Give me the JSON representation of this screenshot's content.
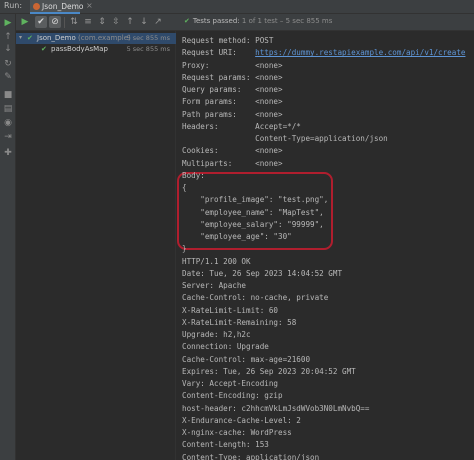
{
  "run_tab": {
    "run_label": "Run:",
    "tab_title": "Json_Demo",
    "close_glyph": "×"
  },
  "toolbar": {
    "buttons": [
      {
        "name": "rerun-icon",
        "glyph": "▶"
      },
      {
        "name": "show-passed-icon",
        "glyph": "✔"
      },
      {
        "name": "show-ignored-icon",
        "glyph": "⊘"
      },
      {
        "name": "sort-alpha-icon",
        "glyph": "⇅"
      },
      {
        "name": "sort-duration-icon",
        "glyph": "≡"
      },
      {
        "name": "expand-all-icon",
        "glyph": "⇕"
      },
      {
        "name": "collapse-all-icon",
        "glyph": "⇳"
      },
      {
        "name": "previous-icon",
        "glyph": "↑"
      },
      {
        "name": "next-icon",
        "glyph": "↓"
      },
      {
        "name": "export-icon",
        "glyph": "↗"
      },
      {
        "name": "history-icon",
        "glyph": "◷"
      },
      {
        "name": "settings-icon",
        "glyph": "⚙"
      }
    ],
    "status_check": "✔",
    "status_passed": "Tests passed:",
    "status_rest": " 1 of 1 test – 5 sec 855 ms"
  },
  "left_toolbar": {
    "buttons": [
      {
        "name": "run-icon",
        "glyph": "▶"
      },
      {
        "name": "up-icon",
        "glyph": "↑"
      },
      {
        "name": "down-icon",
        "glyph": "↓"
      },
      {
        "name": "rerun-failed-icon",
        "glyph": "↻"
      },
      {
        "name": "wrench-icon",
        "glyph": "✎"
      },
      {
        "name": "stop-icon",
        "glyph": "■"
      },
      {
        "name": "layout-icon",
        "glyph": "▤"
      },
      {
        "name": "camera-icon",
        "glyph": "◉"
      },
      {
        "name": "exit-icon",
        "glyph": "⇥"
      },
      {
        "name": "pin-icon",
        "glyph": "✚"
      }
    ]
  },
  "tree": {
    "root": {
      "arrow": "▾",
      "check": "✔",
      "name": "Json_Demo",
      "sub": " (com.example)",
      "time": "5 sec 855 ms"
    },
    "child": {
      "check": "✔",
      "name": "passBodyAsMap",
      "time": "5 sec 855 ms"
    }
  },
  "console": {
    "lines": [
      "Request method: POST",
      "Request URI:    ",
      "Proxy:          <none>",
      "Request params: <none>",
      "Query params:   <none>",
      "Form params:    <none>",
      "Path params:    <none>",
      "Headers:        Accept=*/*",
      "                Content-Type=application/json",
      "Cookies:        <none>",
      "Multiparts:     <none>",
      "Body:",
      "{",
      "    \"profile_image\": \"test.png\",",
      "    \"employee_name\": \"MapTest\",",
      "    \"employee_salary\": \"99999\",",
      "    \"employee_age\": \"30\"",
      "}",
      "HTTP/1.1 200 OK",
      "Date: Tue, 26 Sep 2023 14:04:52 GMT",
      "Server: Apache",
      "Cache-Control: no-cache, private",
      "X-RateLimit-Limit: 60",
      "X-RateLimit-Remaining: 58",
      "Upgrade: h2,h2c",
      "Connection: Upgrade",
      "Cache-Control: max-age=21600",
      "Expires: Tue, 26 Sep 2023 20:04:52 GMT",
      "Vary: Accept-Encoding",
      "Content-Encoding: gzip",
      "host-header: c2hhcmVkLmJsdWVob3N0LmNvbQ==",
      "X-Endurance-Cache-Level: 2",
      "X-nginx-cache: WordPress",
      "Content-Length: 153",
      "Content-Type: application/json"
    ],
    "request_uri_link": "https://dummy.restapiexample.com/api/v1/create"
  },
  "colors": {
    "highlight_border": "#b01e2e",
    "pass_green": "#5fb35f",
    "link_blue": "#5e95d6"
  }
}
